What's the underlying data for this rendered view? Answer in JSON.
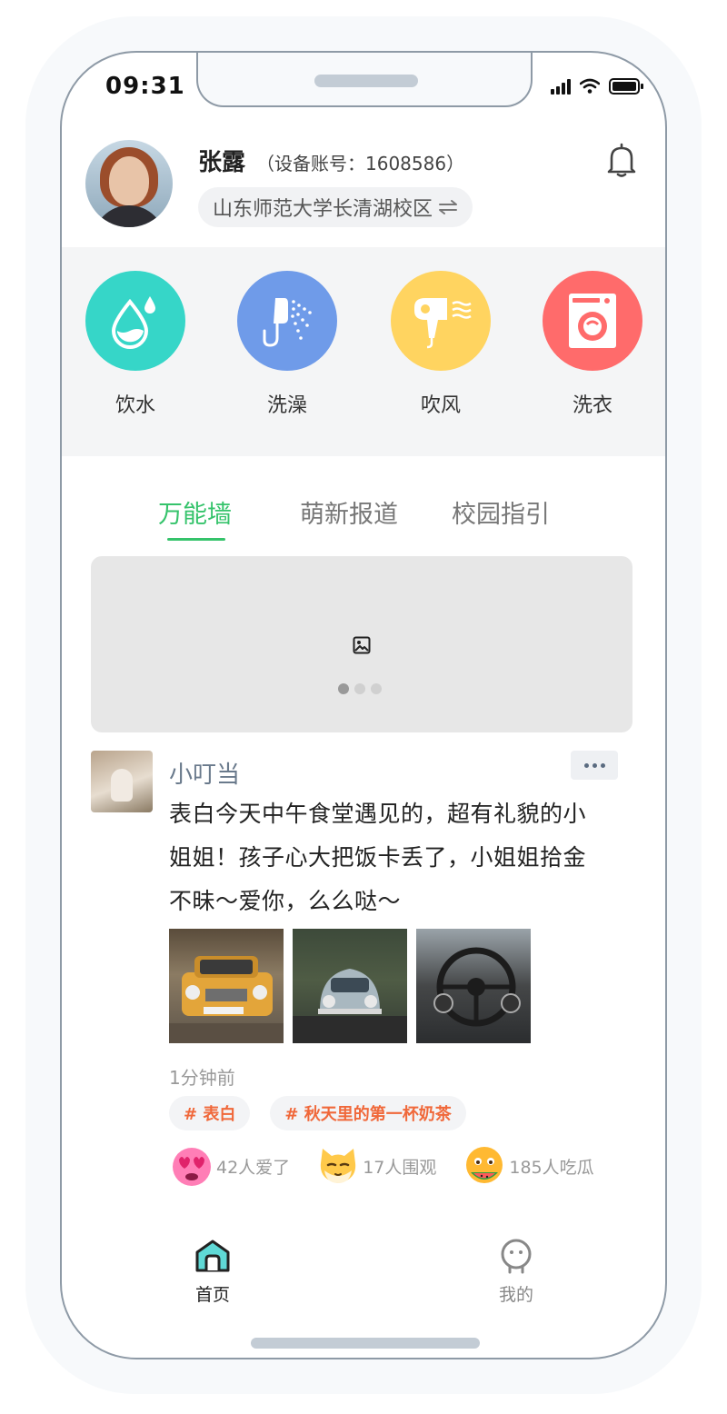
{
  "status_bar": {
    "time": "09:31"
  },
  "user": {
    "name": "张露",
    "account": "（设备账号：1608586）",
    "campus": "山东师范大学长清湖校区",
    "campus_switch_icon": "swap-icon"
  },
  "services": [
    {
      "label": "饮水",
      "icon": "water-drop-icon",
      "color": "#36d6c8"
    },
    {
      "label": "洗澡",
      "icon": "shower-icon",
      "color": "#6f9be9"
    },
    {
      "label": "吹风",
      "icon": "hair-dryer-icon",
      "color": "#ffd460"
    },
    {
      "label": "洗衣",
      "icon": "washing-machine-icon",
      "color": "#ff6b6b"
    }
  ],
  "tabs": [
    {
      "label": "万能墙",
      "active": true
    },
    {
      "label": "萌新报道",
      "active": false
    },
    {
      "label": "校园指引",
      "active": false
    }
  ],
  "banner": {
    "slides": 3,
    "active_slide": 1
  },
  "post": {
    "author": "小叮当",
    "text": "表白今天中午食堂遇见的，超有礼貌的小姐姐！孩子心大把饭卡丢了，小姐姐拾金不昧～爱你，么么哒～",
    "time": "1分钟前",
    "tags": [
      "# 表白",
      "# 秋天里的第一杯奶茶"
    ],
    "reactions": [
      {
        "label": "42人爱了",
        "icon": "heart-eyes-emoji-icon"
      },
      {
        "label": "17人围观",
        "icon": "cat-face-emoji-icon"
      },
      {
        "label": "185人吃瓜",
        "icon": "watermelon-emoji-icon"
      }
    ]
  },
  "bottom_nav": [
    {
      "label": "首页",
      "icon": "home-icon",
      "active": true
    },
    {
      "label": "我的",
      "icon": "profile-icon",
      "active": false
    }
  ],
  "colors": {
    "accent": "#35c36b",
    "tag": "#f0683a",
    "author": "#6a7a8c"
  }
}
